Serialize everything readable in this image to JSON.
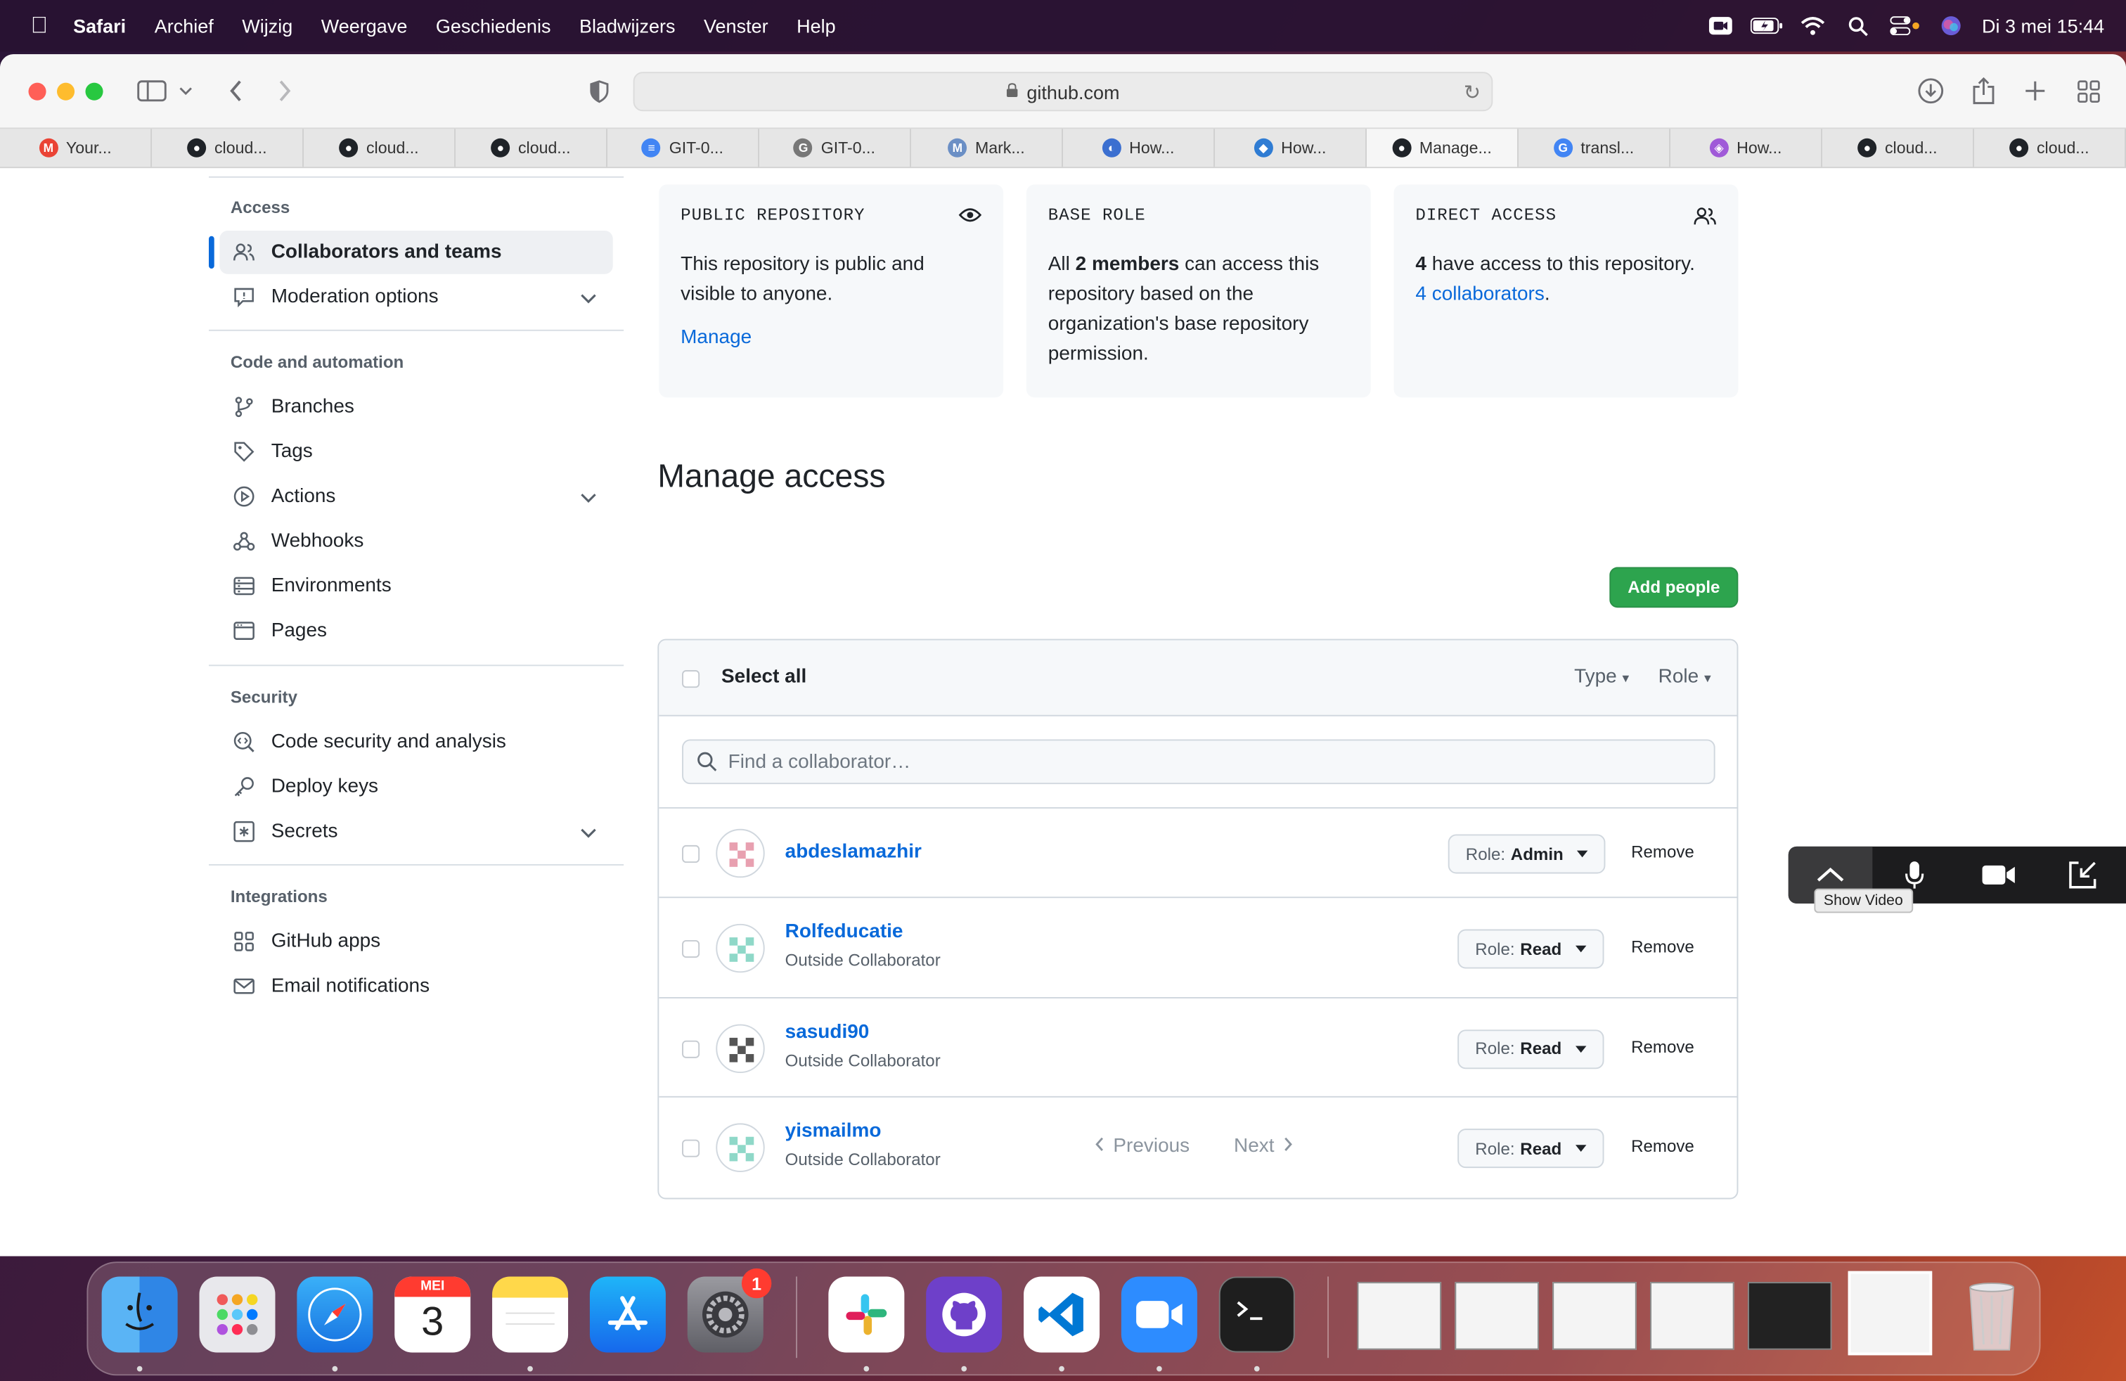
{
  "menubar": {
    "app": "Safari",
    "items": [
      "Archief",
      "Wijzig",
      "Weergave",
      "Geschiedenis",
      "Bladwijzers",
      "Venster",
      "Help"
    ],
    "datetime": "Di 3 mei  15:44"
  },
  "browser": {
    "url": "github.com",
    "tabs": [
      {
        "label": "Your...",
        "icon": "gmail-icon",
        "color": "#ea4335",
        "glyph": "M"
      },
      {
        "label": "cloud...",
        "icon": "github-icon",
        "color": "#1f2328",
        "glyph": "●"
      },
      {
        "label": "cloud...",
        "icon": "github-icon",
        "color": "#1f2328",
        "glyph": "●"
      },
      {
        "label": "cloud...",
        "icon": "github-icon",
        "color": "#1f2328",
        "glyph": "●"
      },
      {
        "label": "GIT-0...",
        "icon": "docs-icon",
        "color": "#4285f4",
        "glyph": "≡"
      },
      {
        "label": "GIT-0...",
        "icon": "gitbook-icon",
        "color": "#777777",
        "glyph": "G"
      },
      {
        "label": "Mark...",
        "icon": "markdown-icon",
        "color": "#6b8fc5",
        "glyph": "M"
      },
      {
        "label": "How...",
        "icon": "globe-icon",
        "color": "#3b6fd0",
        "glyph": "◐"
      },
      {
        "label": "How...",
        "icon": "azure-icon",
        "color": "#2f7cd3",
        "glyph": "◆"
      },
      {
        "label": "Manage...",
        "icon": "github-icon",
        "color": "#1f2328",
        "glyph": "●"
      },
      {
        "label": "transl...",
        "icon": "google-icon",
        "color": "#4285f4",
        "glyph": "G"
      },
      {
        "label": "How...",
        "icon": "app-icon",
        "color": "#a05ad8",
        "glyph": "◈"
      },
      {
        "label": "cloud...",
        "icon": "github-icon",
        "color": "#1f2328",
        "glyph": "●"
      },
      {
        "label": "cloud...",
        "icon": "github-icon",
        "color": "#1f2328",
        "glyph": "●"
      }
    ],
    "active_tab": 9
  },
  "sidebar": {
    "access": {
      "heading": "Access",
      "collaborators": "Collaborators and teams",
      "moderation": "Moderation options"
    },
    "code": {
      "heading": "Code and automation",
      "branches": "Branches",
      "tags": "Tags",
      "actions": "Actions",
      "webhooks": "Webhooks",
      "environments": "Environments",
      "pages": "Pages"
    },
    "security": {
      "heading": "Security",
      "code_security": "Code security and analysis",
      "deploy_keys": "Deploy keys",
      "secrets": "Secrets"
    },
    "integrations": {
      "heading": "Integrations",
      "github_apps": "GitHub apps",
      "email_notifications": "Email notifications"
    }
  },
  "cards": {
    "public": {
      "title": "PUBLIC REPOSITORY",
      "line1": "This repository is public and",
      "line2": "visible to anyone.",
      "link": "Manage"
    },
    "base_role": {
      "title": "BASE ROLE",
      "prefix": "All ",
      "bold": "2 members",
      "suffix": " can access this",
      "line2": "repository based on the",
      "line3": "organization's base repository",
      "line4": "permission."
    },
    "direct": {
      "title": "DIRECT ACCESS",
      "bold": "4",
      "text": " have access to this repository.",
      "link": "4 collaborators",
      "period": "."
    }
  },
  "manage": {
    "title": "Manage access",
    "add_button": "Add people",
    "select_all": "Select all",
    "type_filter": "Type",
    "role_filter": "Role",
    "search_placeholder": "Find a collaborator…",
    "role_prefix": "Role:",
    "remove_label": "Remove",
    "collaborators": [
      {
        "name": "abdeslamazhir",
        "subtitle": "",
        "role": "Admin",
        "avatar_color": "#e8a0b0"
      },
      {
        "name": "Rolfeducatie",
        "subtitle": "Outside Collaborator",
        "role": "Read",
        "avatar_color": "#8fd8c8"
      },
      {
        "name": "sasudi90",
        "subtitle": "Outside Collaborator",
        "role": "Read",
        "avatar_color": "#555555"
      },
      {
        "name": "yismailmo",
        "subtitle": "Outside Collaborator",
        "role": "Read",
        "avatar_color": "#8fd8c8"
      }
    ],
    "previous": "Previous",
    "next": "Next"
  },
  "video_toolbar": {
    "tooltip": "Show Video"
  },
  "dock": {
    "calendar_month": "MEI",
    "calendar_day": "3",
    "settings_badge": "1"
  }
}
